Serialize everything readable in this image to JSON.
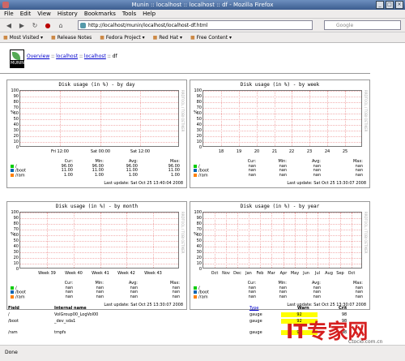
{
  "window": {
    "title": "Munin :: localhost :: localhost :: df - Mozilla Firefox"
  },
  "menu": [
    "File",
    "Edit",
    "View",
    "History",
    "Bookmarks",
    "Tools",
    "Help"
  ],
  "address": "http://localhost/munin/localhost/localhost-df.html",
  "search_placeholder": "Google",
  "bookmarks": [
    "Most Visited ▾",
    "Release Notes",
    "Fedora Project ▾",
    "Red Hat ▾",
    "Free Content ▾"
  ],
  "logo_text": "MUNIN",
  "breadcrumb": {
    "overview": "Overview",
    "localhost1": "localhost",
    "localhost2": "localhost",
    "current": "df"
  },
  "charts": [
    {
      "title": "Disk usage (in %) - by day",
      "xticks": [
        "Fri 12:00",
        "Sat 00:00",
        "Sat 12:00"
      ],
      "update": "Last update: Sat Oct 25 13:40:04 2008",
      "rows": [
        [
          "/",
          "96.00",
          "96.00",
          "96.00",
          "96.00"
        ],
        [
          "/boot",
          "11.00",
          "11.00",
          "11.00",
          "11.00"
        ],
        [
          "/ram",
          "1.00",
          "1.00",
          "1.00",
          "1.00"
        ]
      ]
    },
    {
      "title": "Disk usage (in %) - by week",
      "xticks": [
        "18",
        "19",
        "20",
        "21",
        "22",
        "23",
        "24",
        "25"
      ],
      "update": "Last update: Sat Oct 25 13:30:07 2008",
      "rows": [
        [
          "/",
          "nan",
          "nan",
          "nan",
          "nan"
        ],
        [
          "/boot",
          "nan",
          "nan",
          "nan",
          "nan"
        ],
        [
          "/ram",
          "nan",
          "nan",
          "nan",
          "nan"
        ]
      ]
    },
    {
      "title": "Disk usage (in %) - by month",
      "xticks": [
        "Week 39",
        "Week 40",
        "Week 41",
        "Week 42",
        "Week 43"
      ],
      "update": "Last update: Sat Oct 25 13:30:07 2008",
      "rows": [
        [
          "/",
          "nan",
          "nan",
          "nan",
          "nan"
        ],
        [
          "/boot",
          "nan",
          "nan",
          "nan",
          "nan"
        ],
        [
          "/ram",
          "nan",
          "nan",
          "nan",
          "nan"
        ]
      ]
    },
    {
      "title": "Disk usage (in %) - by year",
      "xticks": [
        "Oct",
        "Nov",
        "Dec",
        "Jan",
        "Feb",
        "Mar",
        "Apr",
        "May",
        "Jun",
        "Jul",
        "Aug",
        "Sep",
        "Oct"
      ],
      "update": "Last update: Sat Oct 25 13:30:07 2008",
      "rows": [
        [
          "/",
          "nan",
          "nan",
          "nan",
          "nan"
        ],
        [
          "/boot",
          "nan",
          "nan",
          "nan",
          "nan"
        ],
        [
          "/ram",
          "nan",
          "nan",
          "nan",
          "nan"
        ]
      ]
    }
  ],
  "y_ticks": [
    "100",
    "90",
    "80",
    "70",
    "60",
    "50",
    "40",
    "30",
    "20",
    "10",
    "0"
  ],
  "y_label": "%",
  "side_label": "RRDTOOL / TOBI OETIKER",
  "legend_headers": [
    "Cur:",
    "Min:",
    "Avg:",
    "Max:"
  ],
  "table": {
    "headers": [
      "Field",
      "Internal name",
      "Type",
      "Warn",
      "Crit"
    ],
    "rows": [
      [
        "/",
        "VolGroup00_LogVol00",
        "gauge",
        "92",
        "98"
      ],
      [
        "/boot",
        "_dev_sda1",
        "gauge",
        "92",
        "98"
      ],
      [
        "/ram",
        "tmpfs",
        "gauge",
        "92",
        "98"
      ]
    ]
  },
  "status": "Done",
  "watermark": {
    "main": "IT专家网",
    "sub": "Ctocio.com.cn"
  },
  "colors": {
    "series1": "#00cc00",
    "series2": "#0066b3",
    "series3": "#ff8000",
    "warn_bg": "#ffff00"
  }
}
